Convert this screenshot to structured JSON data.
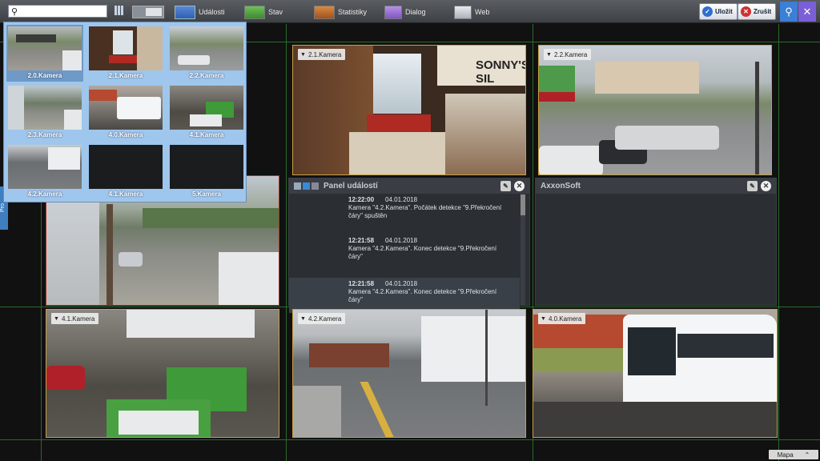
{
  "toolbar": {
    "search_placeholder": "",
    "items": [
      {
        "label": "Události"
      },
      {
        "label": "Stav"
      },
      {
        "label": "Statistiky"
      },
      {
        "label": "Dialog"
      },
      {
        "label": "Web"
      }
    ],
    "save_label": "Uložit",
    "cancel_label": "Zrušit"
  },
  "popup": {
    "thumbs": [
      {
        "label": "2.0.Kamera"
      },
      {
        "label": "2.1.Kamera"
      },
      {
        "label": "2.2.Kamera"
      },
      {
        "label": "2.3.Kamera"
      },
      {
        "label": "4.0.Kamera"
      },
      {
        "label": "4.1.Kamera"
      },
      {
        "label": "4.2.Kamera"
      },
      {
        "label": "4.1.Kamera"
      },
      {
        "label": "5.Kamera"
      }
    ]
  },
  "cameras": {
    "c21": {
      "label": "2.1.Kamera"
    },
    "c22": {
      "label": "2.2.Kamera"
    },
    "c41": {
      "label": "4.1.Kamera"
    },
    "c42": {
      "label": "4.2.Kamera"
    },
    "c40": {
      "label": "4.0.Kamera"
    }
  },
  "event_panel": {
    "title": "Panel událostí",
    "events": [
      {
        "time": "12:22:00",
        "date": "04.01.2018",
        "line1": "Kamera \"4.2.Kamera\". Počátek detekce \"9.Překročení",
        "line2": "čáry\" spuštěn"
      },
      {
        "time": "12:21:58",
        "date": "04.01.2018",
        "line1": "Kamera \"4.2.Kamera\". Konec detekce \"9.Překročení",
        "line2": "čáry\""
      },
      {
        "time": "12:21:58",
        "date": "04.01.2018",
        "line1": "Kamera \"4.2.Kamera\". Konec detekce \"9.Překročení",
        "line2": "čáry\""
      }
    ]
  },
  "axxon_panel": {
    "title": "AxxonSoft"
  },
  "side_tab": {
    "label": "Pro"
  },
  "footer": {
    "map_label": "Mapa"
  },
  "colors": {
    "accent": "#9fc6ec",
    "grid": "#2a6a2a",
    "camera_border": "#c8a040",
    "alarm_border": "#b03020"
  }
}
